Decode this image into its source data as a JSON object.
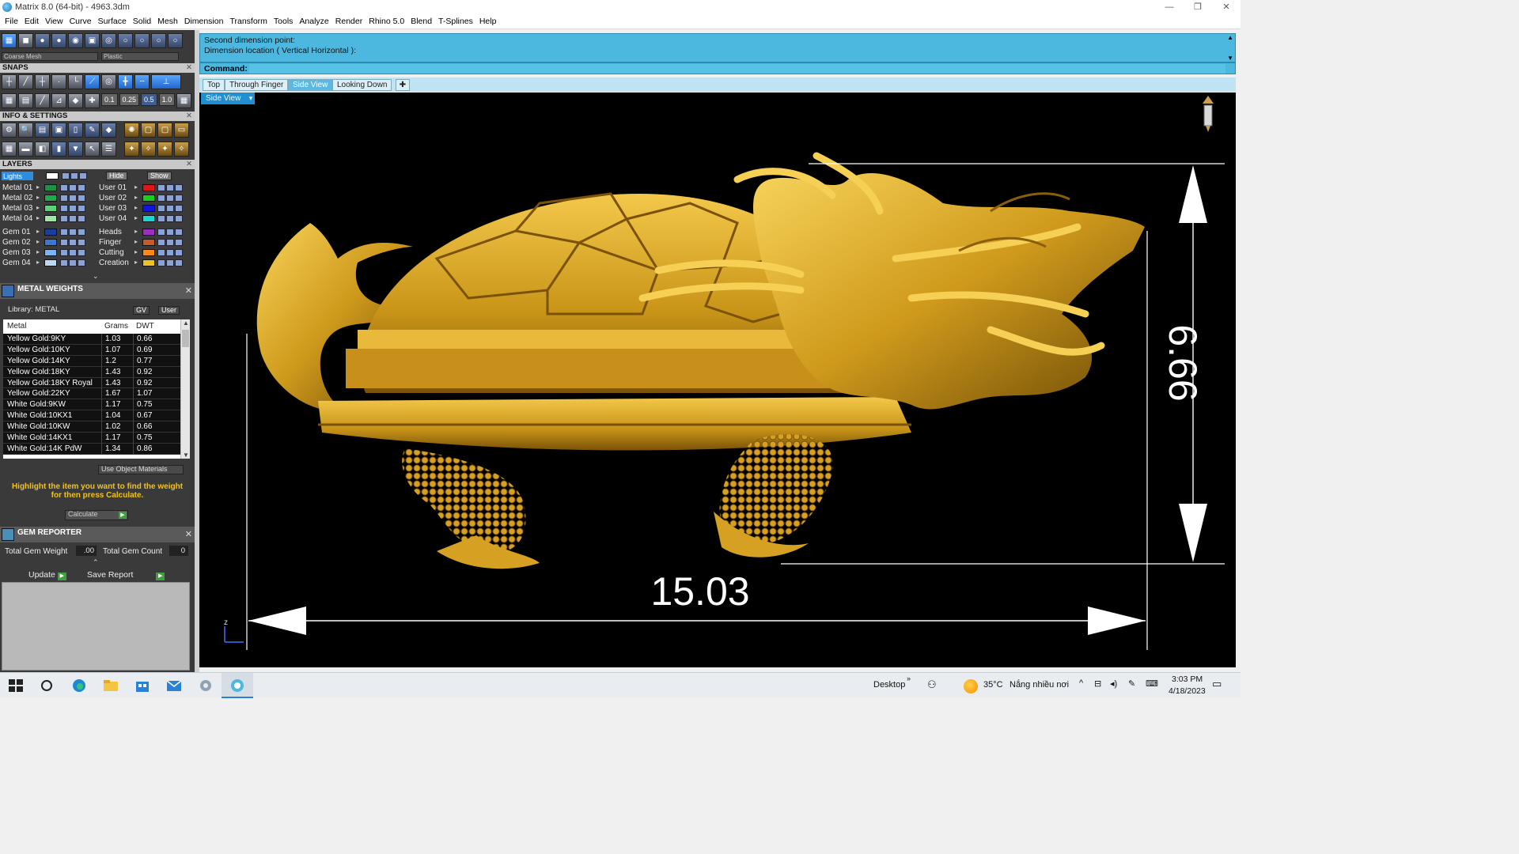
{
  "titlebar": {
    "title": "Matrix 8.0 (64-bit) - 4963.3dm",
    "minimize": "—",
    "restore": "❐",
    "close": "✕"
  },
  "menu": [
    "File",
    "Edit",
    "View",
    "Curve",
    "Surface",
    "Solid",
    "Mesh",
    "Dimension",
    "Transform",
    "Tools",
    "Analyze",
    "Render",
    "Rhino 5.0",
    "Blend",
    "T-Splines",
    "Help"
  ],
  "display": {
    "mesh_mode": "Coarse Mesh",
    "material": "Plastic"
  },
  "snaps": {
    "title": "SNAPS",
    "increments": [
      "0.1",
      "0.25",
      "0.5",
      "1.0"
    ]
  },
  "info_settings": {
    "title": "INFO & SETTINGS"
  },
  "layers": {
    "title": "LAYERS",
    "lights_label": "Lights",
    "hide_label": "Hide",
    "show_label": "Show",
    "left": [
      {
        "name": "Metal 01",
        "color": "#1f8f4a"
      },
      {
        "name": "Metal 02",
        "color": "#22a84d"
      },
      {
        "name": "Metal 03",
        "color": "#5fd07a"
      },
      {
        "name": "Metal 04",
        "color": "#9de8a8"
      },
      {
        "name": "Gem 01",
        "color": "#1b3f9c"
      },
      {
        "name": "Gem 02",
        "color": "#3a78d6"
      },
      {
        "name": "Gem 03",
        "color": "#7fb3ee"
      },
      {
        "name": "Gem 04",
        "color": "#bcd8f8"
      }
    ],
    "right": [
      {
        "name": "User 01",
        "color": "#e01515"
      },
      {
        "name": "User 02",
        "color": "#18d018"
      },
      {
        "name": "User 03",
        "color": "#1414e0"
      },
      {
        "name": "User 04",
        "color": "#17d6d6"
      },
      {
        "name": "Heads",
        "color": "#9a2fc0"
      },
      {
        "name": "Finger",
        "color": "#c85a2a"
      },
      {
        "name": "Cutting",
        "color": "#ff8a1a"
      },
      {
        "name": "Creation",
        "color": "#f0c020"
      }
    ]
  },
  "metal_weights": {
    "title": "METAL WEIGHTS",
    "library_label": "Library: METAL",
    "btn_gv": "GV",
    "btn_user": "User",
    "columns": [
      "Metal",
      "Grams",
      "DWT"
    ],
    "rows": [
      [
        "Yellow Gold:9KY",
        "1.03",
        "0.66"
      ],
      [
        "Yellow Gold:10KY",
        "1.07",
        "0.69"
      ],
      [
        "Yellow Gold:14KY",
        "1.2",
        "0.77"
      ],
      [
        "Yellow Gold:18KY",
        "1.43",
        "0.92"
      ],
      [
        "Yellow Gold:18KY Royal",
        "1.43",
        "0.92"
      ],
      [
        "Yellow Gold:22KY",
        "1.67",
        "1.07"
      ],
      [
        "White Gold:9KW",
        "1.17",
        "0.75"
      ],
      [
        "White Gold:10KX1",
        "1.04",
        "0.67"
      ],
      [
        "White Gold:10KW",
        "1.02",
        "0.66"
      ],
      [
        "White Gold:14KX1",
        "1.17",
        "0.75"
      ],
      [
        "White Gold:14K PdW",
        "1.34",
        "0.86"
      ]
    ],
    "use_object_materials": "Use Object Materials",
    "hint": "Highlight the item you want to find the weight for then press Calculate.",
    "calculate": "Calculate"
  },
  "gem_reporter": {
    "title": "GEM REPORTER",
    "total_weight_label": "Total Gem Weight",
    "total_weight_value": ".00",
    "total_count_label": "Total Gem Count",
    "total_count_value": "0",
    "update": "Update",
    "save_report": "Save Report"
  },
  "command": {
    "history": [
      "Second dimension point:",
      "Dimension location ( Vertical  Horizontal ):"
    ],
    "label": "Command:",
    "value": ""
  },
  "view_tabs": [
    {
      "label": "Top",
      "active": false
    },
    {
      "label": "Through Finger",
      "active": false
    },
    {
      "label": "Side View",
      "active": true
    },
    {
      "label": "Looking Down",
      "active": false
    }
  ],
  "viewport": {
    "active_view": "Side View",
    "dim_horizontal": "15.03",
    "dim_vertical": "6.66",
    "axis_label": "z",
    "model_color": "#d7a21c"
  },
  "taskbar": {
    "desktop": "Desktop",
    "weather_temp": "35°C",
    "weather_text": "Nắng nhiều nơi",
    "time": "3:03 PM",
    "date": "4/18/2023"
  }
}
